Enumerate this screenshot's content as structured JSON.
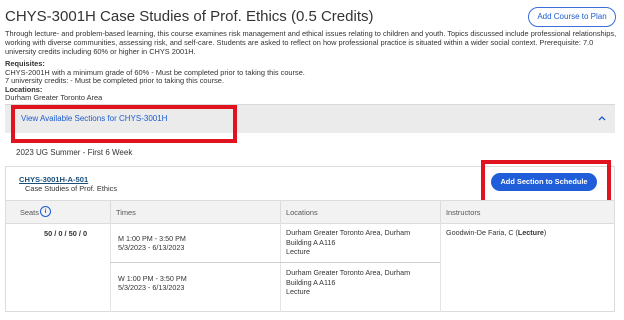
{
  "course": {
    "title": "CHYS-3001H Case Studies of Prof. Ethics (0.5 Credits)",
    "add_button": "Add Course to Plan",
    "description": "Through lecture- and problem-based learning, this course examines risk management and ethical issues relating to children and youth. Topics discussed include professional relationships, working with diverse communities, assessing risk, and self-care. Students are asked to reflect on how professional practice is situated within a wider social context. Prerequisite: 7.0 university credits including 60% or higher in CHYS 2001H.",
    "requisites_label": "Requisites:",
    "requisites": [
      "CHYS-2001H with a minimum grade of 60% - Must be completed prior to taking this course.",
      "7 university credits: - Must be completed prior to taking this course."
    ],
    "locations_label": "Locations:",
    "location": "Durham Greater Toronto Area"
  },
  "sections_toggle": {
    "label": "View Available Sections for CHYS-3001H",
    "icon": "chevron-up-icon"
  },
  "term": "2023 UG Summer - First 6 Week",
  "section": {
    "code": "CHYS-3001H-A-501",
    "name": "Case Studies of Prof. Ethics",
    "add_button": "Add Section to Schedule",
    "table": {
      "headers": [
        "Seats",
        "Times",
        "Locations",
        "Instructors"
      ],
      "seats": "50 / 0 / 50 / 0",
      "instructor_name": "Goodwin-De Faria, C (",
      "instructor_role": "Lecture",
      "instructor_close": ")",
      "meetings": [
        {
          "time": "M 1:00 PM - 3:50 PM",
          "dates": "5/3/2023 - 6/13/2023",
          "location": "Durham Greater Toronto Area, Durham",
          "room": "Building A A116",
          "type": "Lecture"
        },
        {
          "time": "W 1:00 PM - 3:50 PM",
          "dates": "5/3/2023 - 6/13/2023",
          "location": "Durham Greater Toronto Area, Durham",
          "room": "Building A A116",
          "type": "Lecture"
        }
      ]
    }
  },
  "colors": {
    "accent": "#1f5ed8",
    "highlight_box": "#e0141e"
  }
}
